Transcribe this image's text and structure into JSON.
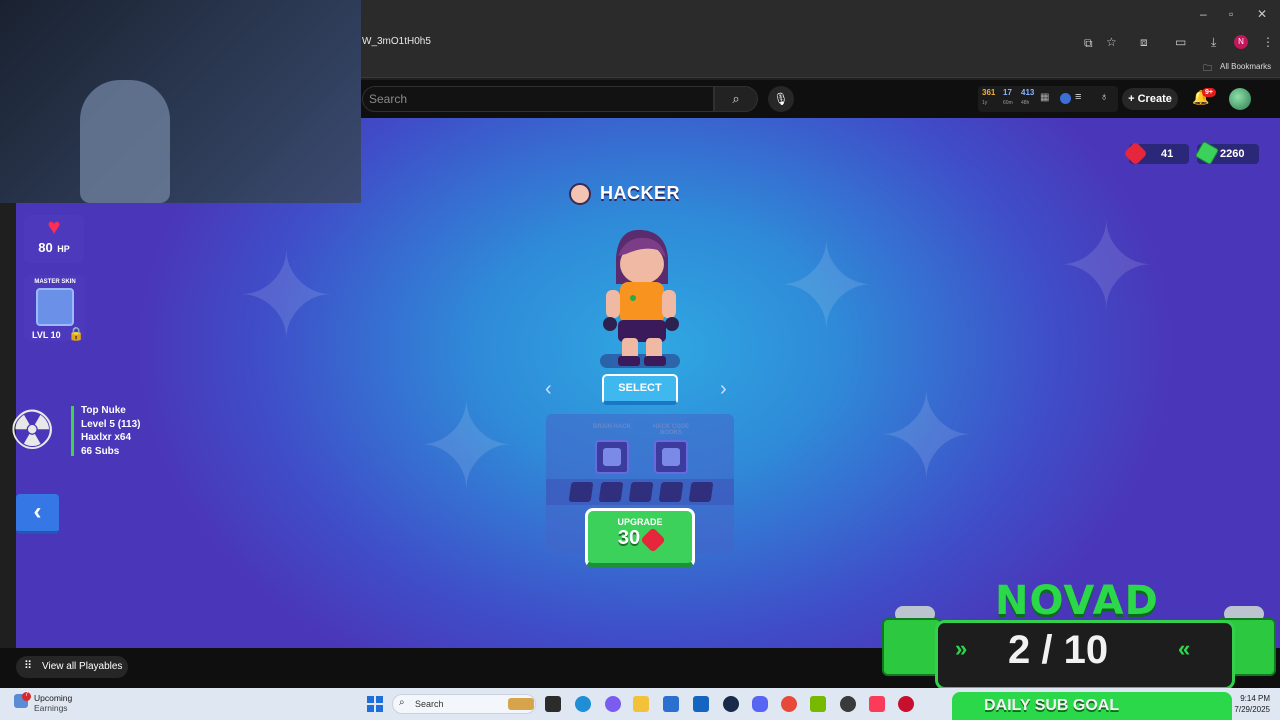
{
  "browser": {
    "url": "W_3mO1tH0h5",
    "bookmarks_label": "All Bookmarks",
    "profile_initial": "N"
  },
  "site_header": {
    "search_placeholder": "Search",
    "stats": [
      {
        "value": "361",
        "label": "1y",
        "color": "#f2b233"
      },
      {
        "value": "17",
        "label": "60m",
        "color": "#8ab4ff"
      },
      {
        "value": "413",
        "label": "48h",
        "color": "#8ab4ff"
      }
    ],
    "create_label": "Create",
    "notifications_badge": "9+"
  },
  "game": {
    "hp": {
      "value": "80",
      "unit": "HP"
    },
    "master_skin": {
      "title": "MASTER SKIN",
      "level": "LVL 10"
    },
    "top_nuke": {
      "lines": [
        "Top Nuke",
        "Level 5  (113)",
        "Haxlxr x64",
        "66 Subs"
      ]
    },
    "character": {
      "name": "HACKER"
    },
    "select_label": "SELECT",
    "perks": [
      {
        "label": "BRAIN HACK"
      },
      {
        "label": "HACK CODE BOOKS"
      }
    ],
    "upgrade": {
      "label": "UPGRADE",
      "cost": "30"
    },
    "currency": {
      "gems": "41",
      "cash": "2260"
    }
  },
  "view_all_label": "View all Playables",
  "sub_goal": {
    "name": "NOVAD",
    "count": "2 / 10",
    "label": "DAILY SUB GOAL",
    "accent": "#2bd84a"
  },
  "taskbar": {
    "weather_title": "Upcoming",
    "weather_sub": "Earnings",
    "weather_badge": "7",
    "search_placeholder": "Search",
    "time": "9:14 PM",
    "date": "7/29/2025"
  }
}
